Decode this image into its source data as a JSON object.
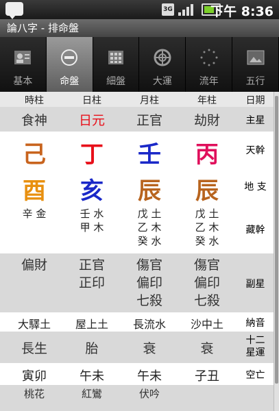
{
  "status": {
    "time": "下午 8:36",
    "network": "3G"
  },
  "app_title": "論八字 - 排命盤",
  "tabs": [
    {
      "label": "基本",
      "icon": "person-card-icon"
    },
    {
      "label": "命盤",
      "icon": "disc-icon"
    },
    {
      "label": "細盤",
      "icon": "grid-icon"
    },
    {
      "label": "大運",
      "icon": "compass-icon"
    },
    {
      "label": "流年",
      "icon": "dots-circle-icon"
    },
    {
      "label": "五行",
      "icon": "picture-icon"
    }
  ],
  "table": {
    "headers": [
      "時柱",
      "日柱",
      "月柱",
      "年柱",
      "日期"
    ],
    "main_star": {
      "cells": [
        "食神",
        "日元",
        "正官",
        "劫財"
      ],
      "label": "主星"
    },
    "heaven_stem": {
      "cells": [
        "己",
        "丁",
        "壬",
        "丙"
      ],
      "label": "天幹"
    },
    "earth_branch": {
      "cells": [
        "酉",
        "亥",
        "辰",
        "辰"
      ],
      "label": "地 支"
    },
    "hidden_stem": {
      "cells": [
        [
          "辛 金"
        ],
        [
          "壬 水",
          "甲 木"
        ],
        [
          "戊 土",
          "乙 木",
          "癸 水"
        ],
        [
          "戊 土",
          "乙 木",
          "癸 水"
        ]
      ],
      "label": "藏幹"
    },
    "sub_star": {
      "cells": [
        [
          "偏財"
        ],
        [
          "正官",
          "正印"
        ],
        [
          "傷官",
          "偏印",
          "七殺"
        ],
        [
          "傷官",
          "偏印",
          "七殺"
        ]
      ],
      "label": "副星"
    },
    "nayin": {
      "cells": [
        "大驛土",
        "屋上土",
        "長流水",
        "沙中土"
      ],
      "label": "納音"
    },
    "twelve_stages": {
      "cells": [
        "長生",
        "胎",
        "衰",
        "衰"
      ],
      "label_lines": [
        "十二",
        "星運"
      ]
    },
    "void": {
      "cells": [
        "寅卯",
        "午未",
        "午未",
        "子丑"
      ],
      "label": "空亡"
    },
    "shensha": {
      "cells": [
        "桃花",
        "紅鸞",
        "伏吟",
        ""
      ],
      "label": ""
    }
  },
  "colors": {
    "stem_ji": "#c8641e",
    "stem_ding": "#e8101a",
    "stem_ren": "#1a28c8",
    "stem_bing": "#e0105c",
    "branch_you": "#e89010",
    "branch_hai": "#1a28c8",
    "branch_chen": "#b8641e",
    "day_master": "#e8101a"
  }
}
